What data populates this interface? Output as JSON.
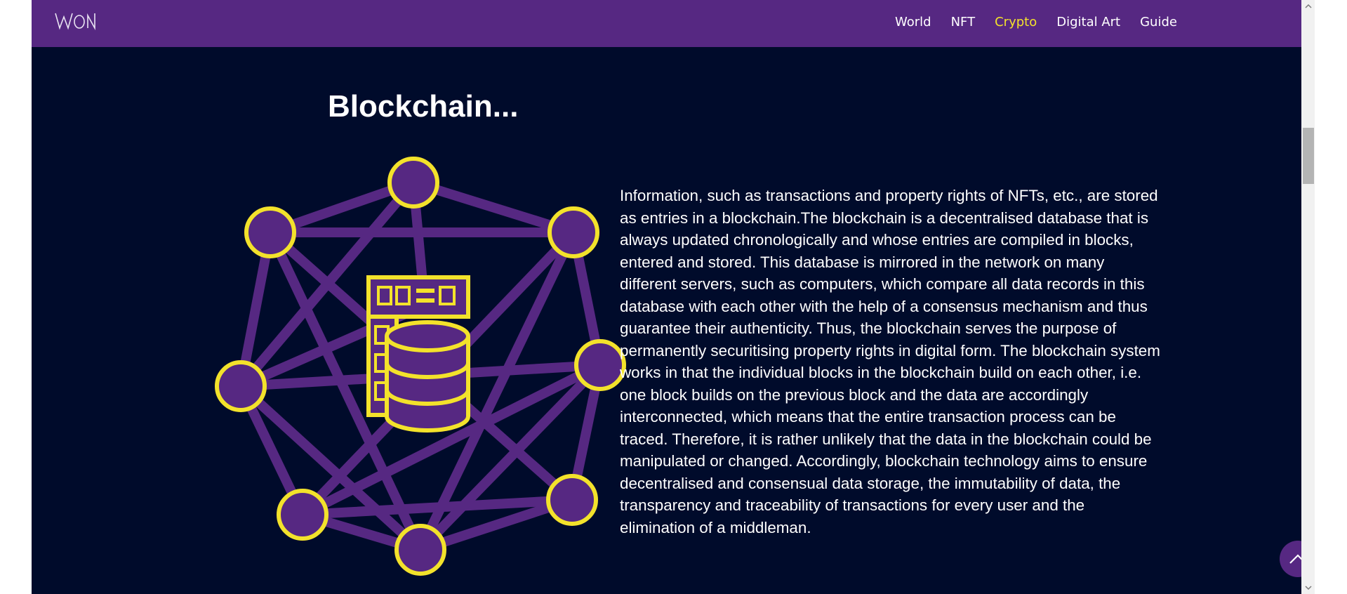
{
  "brand": {
    "logo_text": "WON"
  },
  "nav": {
    "items": [
      {
        "label": "World",
        "active": false
      },
      {
        "label": "NFT",
        "active": false
      },
      {
        "label": "Crypto",
        "active": true
      },
      {
        "label": "Digital Art",
        "active": false
      },
      {
        "label": "Guide",
        "active": false
      }
    ]
  },
  "section": {
    "title": "Blockchain...",
    "illustration": "blockchain-network-illustration",
    "body": "Information, such as transactions and property rights of NFTs, etc., are stored as entries in a blockchain.The blockchain is a decentralised database that is always updated chronologically and whose entries are compiled in blocks, entered and stored. This database is mirrored in the network on many different servers, such as computers, which compare all data records in this database with each other with the help of a consensus mechanism and thus guarantee their authenticity. Thus, the blockchain serves the purpose of permanently securitising property rights in digital form. The blockchain system works in that the individual blocks in the blockchain build on each other, i.e. one block builds on the previous block and the data are accordingly interconnected, which means that the entire transaction process can be traced. Therefore, it is rather unlikely that the data in the blockchain could be manipulated or changed. Accordingly, blockchain technology aims to ensure decentralised and consensual data storage, the immutability of data, the transparency and traceability of transactions for every user and the elimination of a middleman."
  },
  "scroll_to_top": {
    "icon": "chevron-up-icon"
  },
  "colors": {
    "navbar": "#562882",
    "background": "#000b2b",
    "accent_yellow": "#f3e22b",
    "text": "#ffffff"
  }
}
